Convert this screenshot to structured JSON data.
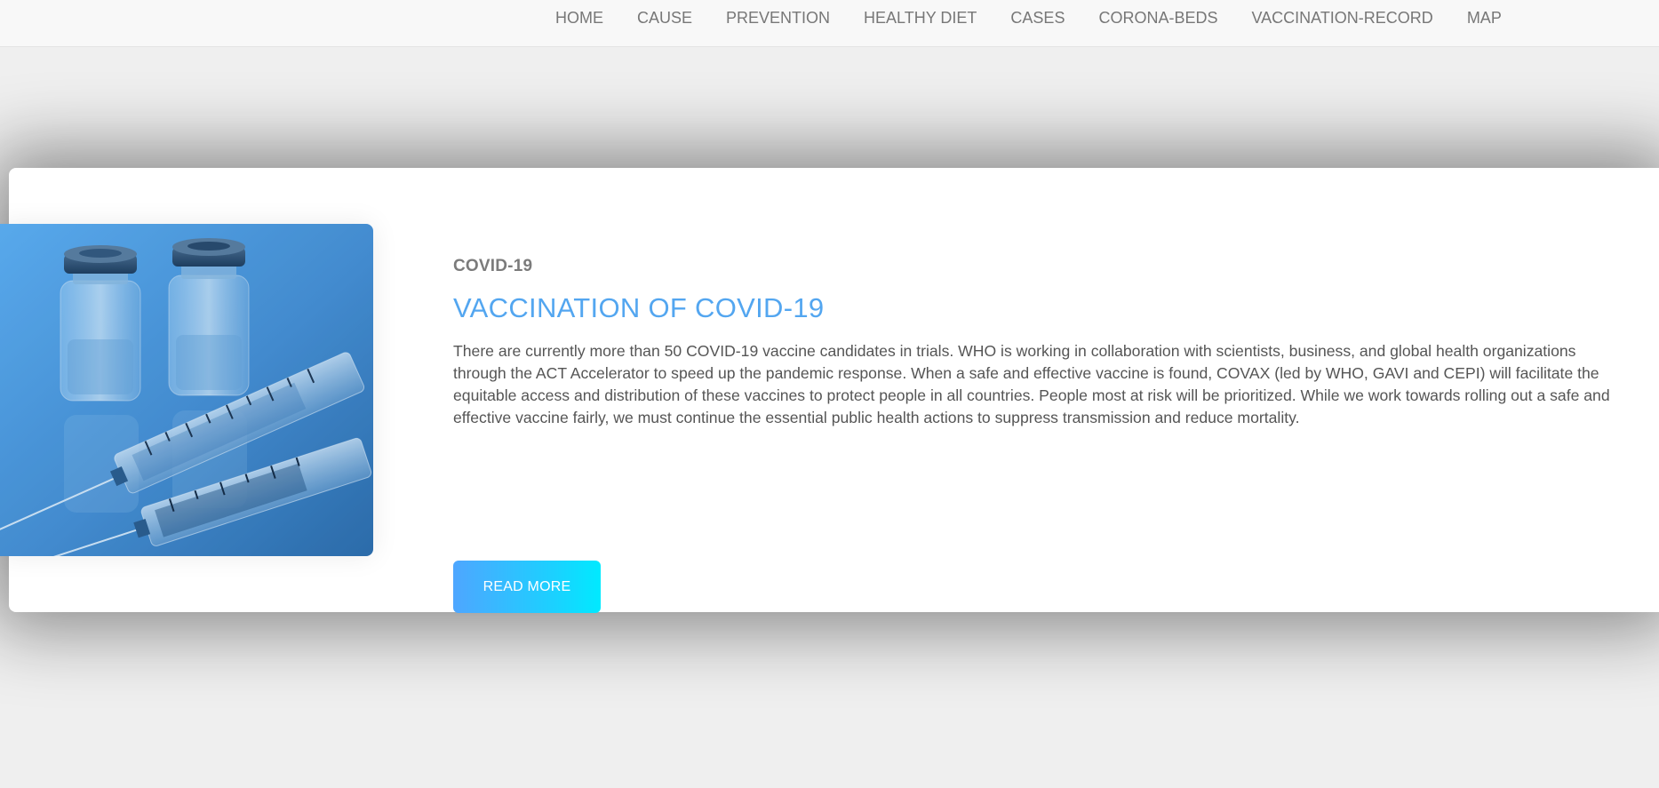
{
  "nav": {
    "items": [
      {
        "label": "HOME"
      },
      {
        "label": "CAUSE"
      },
      {
        "label": "PREVENTION"
      },
      {
        "label": "HEALTHY DIET"
      },
      {
        "label": "CASES"
      },
      {
        "label": "CORONA-BEDS"
      },
      {
        "label": "VACCINATION-RECORD"
      },
      {
        "label": "MAP"
      }
    ]
  },
  "feature": {
    "kicker": "COVID-19",
    "title": "VACCINATION OF COVID-19",
    "description": "There are currently more than 50 COVID-19 vaccine candidates in trials. WHO is working in collaboration with scientists, business, and global health organizations through the ACT Accelerator to speed up the pandemic response. When a safe and effective vaccine is found, COVAX (led by WHO, GAVI and CEPI) will facilitate the equitable access and distribution of these vaccines to protect people in all countries. People most at risk will be prioritized. While we work towards rolling out a safe and effective vaccine fairly, we must continue the essential public health actions to suppress transmission and reduce mortality.",
    "button_label": "READ MORE",
    "image": "vaccine-vials-and-syringes-photo"
  },
  "colors": {
    "accent": "#53a6f0",
    "button_gradient_start": "#4ea6ff",
    "button_gradient_end": "#00eaff",
    "page_background": "#efefef",
    "nav_text": "#777777"
  }
}
